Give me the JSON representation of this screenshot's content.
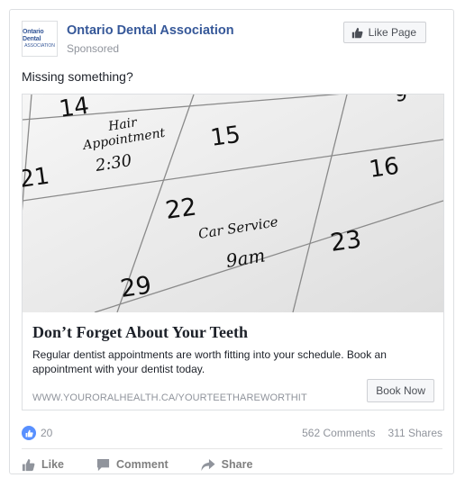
{
  "post": {
    "page_name": "Ontario Dental Association",
    "sponsored_label": "Sponsored",
    "avatar_logo_top": "Ontario Dental",
    "avatar_logo_bottom": "ASSOCIATION",
    "like_page_label": "Like Page",
    "message": "Missing something?"
  },
  "ad": {
    "headline": "Don’t Forget About Your Teeth",
    "description": "Regular dentist appointments are worth fitting into your schedule. Book an appointment with your dentist today.",
    "display_url": "WWW.YOURORALHEALTH.CA/YOURTEETHAREWORTHIT",
    "cta_label": "Book Now",
    "image": {
      "numbers": [
        "14",
        "15",
        "9",
        "21",
        "16",
        "22",
        "23",
        "29"
      ],
      "note1_line1": "Hair",
      "note1_line2": "Appointment",
      "note1_line3": "2:30",
      "note2_line1": "Car Service",
      "note2_line2": "9am"
    }
  },
  "stats": {
    "likes": "20",
    "comments": "562 Comments",
    "shares": "311 Shares"
  },
  "actions": {
    "like": "Like",
    "comment": "Comment",
    "share": "Share"
  },
  "colors": {
    "brand_blue": "#365899",
    "like_badge": "#5890ff"
  }
}
